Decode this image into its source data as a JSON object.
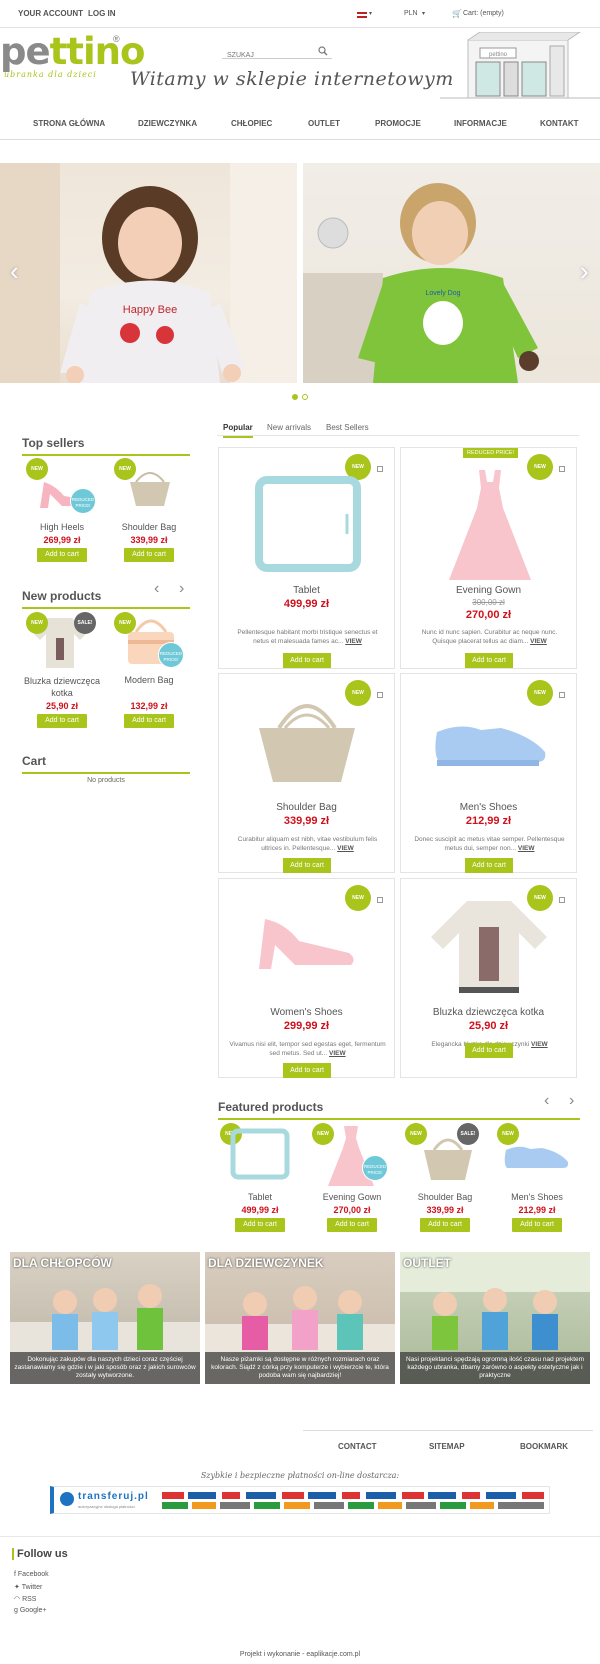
{
  "topbar": {
    "account": "YOUR ACCOUNT",
    "login": "LOG IN",
    "currency": "PLN",
    "cart": "Cart: (empty)"
  },
  "header": {
    "logo_part1": "pe",
    "logo_part2": "ttin",
    "logo_part3": "o",
    "logo_reg": "®",
    "tagline": "ubranka dla dzieci",
    "search_placeholder": "SZUKAJ",
    "welcome": "Witamy w sklepie internetowym",
    "shop_sign": "pettino"
  },
  "nav": [
    "STRONA GŁÓWNA",
    "DZIEWCZYNKA",
    "CHŁOPIEC",
    "OUTLET",
    "PROMOCJE",
    "INFORMACJE",
    "KONTAKT"
  ],
  "slider": {
    "shirt_text": "Happy Bee",
    "shirt_text2": "Lovely Dog"
  },
  "top_sellers": {
    "title": "Top sellers",
    "items": [
      {
        "name": "High Heels",
        "price": "269,99 zł",
        "button": "Add to cart",
        "badge": "NEW",
        "badge2": "REDUCED PRICE!"
      },
      {
        "name": "Shoulder Bag",
        "price": "339,99 zł",
        "button": "Add to cart",
        "badge": "NEW"
      }
    ]
  },
  "new_products": {
    "title": "New products",
    "items": [
      {
        "name": "Bluzka dziewczęca kotka",
        "price": "25,90 zł",
        "button": "Add to cart",
        "badge": "NEW",
        "badge2": "SALE!"
      },
      {
        "name": "Modern Bag",
        "price": "132,99 zł",
        "button": "Add to cart",
        "badge": "NEW",
        "badge2": "REDUCED PRICE!"
      }
    ]
  },
  "cart_block": {
    "title": "Cart",
    "empty": "No products"
  },
  "tabs": [
    "Popular",
    "New arrivals",
    "Best Sellers"
  ],
  "products": [
    {
      "name": "Tablet",
      "price": "499,99 zł",
      "old_price": "",
      "desc": "Pellentesque habitant morbi tristique senectus et netus et malesuada fames ac...",
      "view": "VIEW",
      "button": "Add to cart",
      "badge": "NEW"
    },
    {
      "name": "Evening Gown",
      "price": "270,00 zł",
      "old_price": "300,00 zł",
      "desc": "Nunc id nunc sapien. Curabitur ac neque nunc. Quisque placerat tellus ac diam...",
      "view": "VIEW",
      "button": "Add to cart",
      "badge": "NEW",
      "ribbon": "REDUCED PRICE!"
    },
    {
      "name": "Shoulder Bag",
      "price": "339,99 zł",
      "old_price": "",
      "desc": "Curabitur aliquam est nibh, vitae vestibulum felis ultrices in. Pellentesque...",
      "view": "VIEW",
      "button": "Add to cart",
      "badge": "NEW"
    },
    {
      "name": "Men's Shoes",
      "price": "212,99 zł",
      "old_price": "",
      "desc": "Donec suscipit ac metus vitae semper. Pellentesque metus dui, semper non...",
      "view": "VIEW",
      "button": "Add to cart",
      "badge": "NEW"
    },
    {
      "name": "Women's Shoes",
      "price": "299,99 zł",
      "old_price": "",
      "desc": "Vivamus nisi elit, tempor sed egestas eget, fermentum sed metus. Sed ut...",
      "view": "VIEW",
      "button": "Add to cart",
      "badge": "NEW"
    },
    {
      "name": "Bluzka dziewczęca kotka",
      "price": "25,90 zł",
      "old_price": "",
      "desc": "Elegancka bluzka dla dziewczynki",
      "view": "VIEW",
      "button": "Add to cart",
      "badge": "NEW"
    }
  ],
  "featured": {
    "title": "Featured products",
    "items": [
      {
        "name": "Tablet",
        "price": "499,99 zł",
        "button": "Add to cart",
        "badge": "NEW"
      },
      {
        "name": "Evening Gown",
        "price": "270,00 zł",
        "button": "Add to cart",
        "badge": "NEW",
        "badge2": "REDUCED PRICE!"
      },
      {
        "name": "Shoulder Bag",
        "price": "339,99 zł",
        "button": "Add to cart",
        "badge": "NEW",
        "badge2": "SALE!"
      },
      {
        "name": "Men's Shoes",
        "price": "212,99 zł",
        "button": "Add to cart",
        "badge": "NEW"
      }
    ]
  },
  "banners": [
    {
      "title": "DLA CHŁOPCÓW",
      "desc": "Dokonując zakupów dla naszych dzieci coraz częściej zastanawiamy się gdzie i w jaki sposób oraz z jakich surowców zostały wytworzone."
    },
    {
      "title": "DLA DZIEWCZYNEK",
      "desc": "Nasze piżamki są dostępne w różnych rozmiarach oraz kolorach. Siądź z córką przy komputerze i wybierzcie te, która podoba wam się najbardziej!"
    },
    {
      "title": "OUTLET",
      "desc": "Nasi projektanci spędzają ogromną ilość czasu nad projektem każdego ubranka, dbamy zarówno o aspekty estetyczne jak i praktyczne"
    }
  ],
  "footer_nav": [
    "CONTACT",
    "SITEMAP",
    "BOOKMARK"
  ],
  "payments": {
    "title": "Szybkie i bezpieczne płatności on-line dostarcza:",
    "brand": "transferuj.pl",
    "brand_sub": "autoryzacyjne obsługa płatności"
  },
  "follow": {
    "title": "Follow us",
    "links": [
      "Facebook",
      "Twitter",
      "RSS",
      "Google+"
    ]
  },
  "credits": "Projekt i wykonanie - eaplikacje.com.pl",
  "colors": {
    "accent": "#a9c41a",
    "price": "#d0111b"
  }
}
